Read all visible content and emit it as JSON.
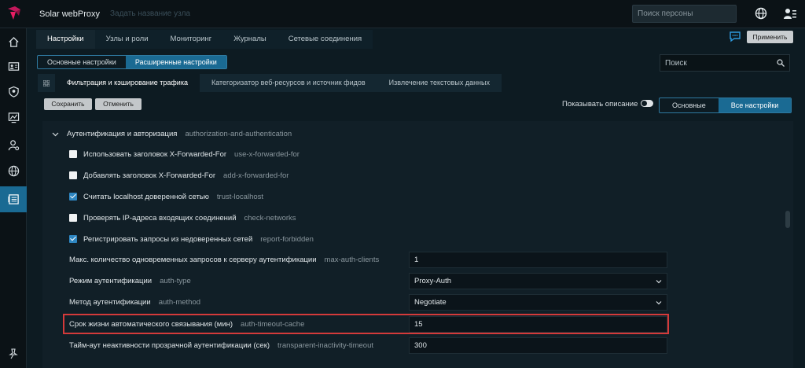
{
  "app": {
    "title": "Solar webProxy",
    "node_placeholder": "Задать название узла"
  },
  "topbar": {
    "person_search_placeholder": "Поиск персоны"
  },
  "main_tabs": [
    "Настройки",
    "Узлы и роли",
    "Мониторинг",
    "Журналы",
    "Сетевые соединения"
  ],
  "apply_label": "Применить",
  "settings_mode": [
    "Основные настройки",
    "Расширенные настройки"
  ],
  "search_placeholder": "Поиск",
  "sub_tabs": [
    "Фильтрация и кэширование трафика",
    "Категоризатор веб-ресурсов и источник фидов",
    "Извлечение текстовых данных"
  ],
  "toolbar": {
    "save": "Сохранить",
    "cancel": "Отменить",
    "show_description": "Показывать описание",
    "view_modes": [
      "Основные",
      "Все настройки"
    ]
  },
  "section": {
    "title": "Аутентификация и авторизация",
    "key": "authorization-and-authentication"
  },
  "checkbox_rows": [
    {
      "label": "Использовать заголовок X-Forwarded-For",
      "key": "use-x-forwarded-for",
      "checked": false
    },
    {
      "label": "Добавлять заголовок X-Forwarded-For",
      "key": "add-x-forwarded-for",
      "checked": false
    },
    {
      "label": "Считать localhost доверенной сетью",
      "key": "trust-localhost",
      "checked": true
    },
    {
      "label": "Проверять IP-адреса входящих соединений",
      "key": "check-networks",
      "checked": false
    },
    {
      "label": "Регистрировать запросы из недоверенных сетей",
      "key": "report-forbidden",
      "checked": true
    }
  ],
  "field_rows": [
    {
      "label": "Макс. количество одновременных запросов к серверу аутентификации",
      "key": "max-auth-clients",
      "value": "1",
      "type": "input"
    },
    {
      "label": "Режим аутентификации",
      "key": "auth-type",
      "value": "Proxy-Auth",
      "type": "select"
    },
    {
      "label": "Метод аутентификации",
      "key": "auth-method",
      "value": "Negotiate",
      "type": "select"
    },
    {
      "label": "Срок жизни автоматического связывания (мин)",
      "key": "auth-timeout-cache",
      "value": "15",
      "type": "input"
    },
    {
      "label": "Тайм-аут неактивности прозрачной аутентификации (сек)",
      "key": "transparent-inactivity-timeout",
      "value": "300",
      "type": "input"
    }
  ],
  "colors": {
    "accent": "#1a6a93",
    "highlight": "#d43a3a",
    "checkbox_checked": "#2e86c1"
  }
}
